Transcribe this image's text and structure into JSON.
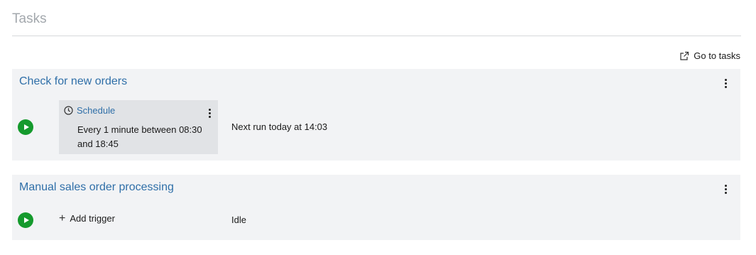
{
  "header": {
    "title": "Tasks",
    "goto_link": "Go to tasks"
  },
  "tasks": [
    {
      "title": "Check for new orders",
      "trigger": {
        "type_label": "Schedule",
        "description": "Every 1 minute between 08:30 and 18:45"
      },
      "status": "Next run today at 14:03"
    },
    {
      "title": "Manual sales order processing",
      "add_trigger_label": "Add trigger",
      "status": "Idle"
    }
  ],
  "icons": {
    "external_link": "external-link-icon",
    "clock": "clock-icon",
    "kebab": "more-vertical-icon",
    "play": "play-icon",
    "plus": "plus-icon"
  },
  "colors": {
    "accent": "#2f6fa8",
    "run_button": "#159a2d",
    "card_bg": "#f2f3f5",
    "trigger_bg": "#e1e3e6"
  }
}
